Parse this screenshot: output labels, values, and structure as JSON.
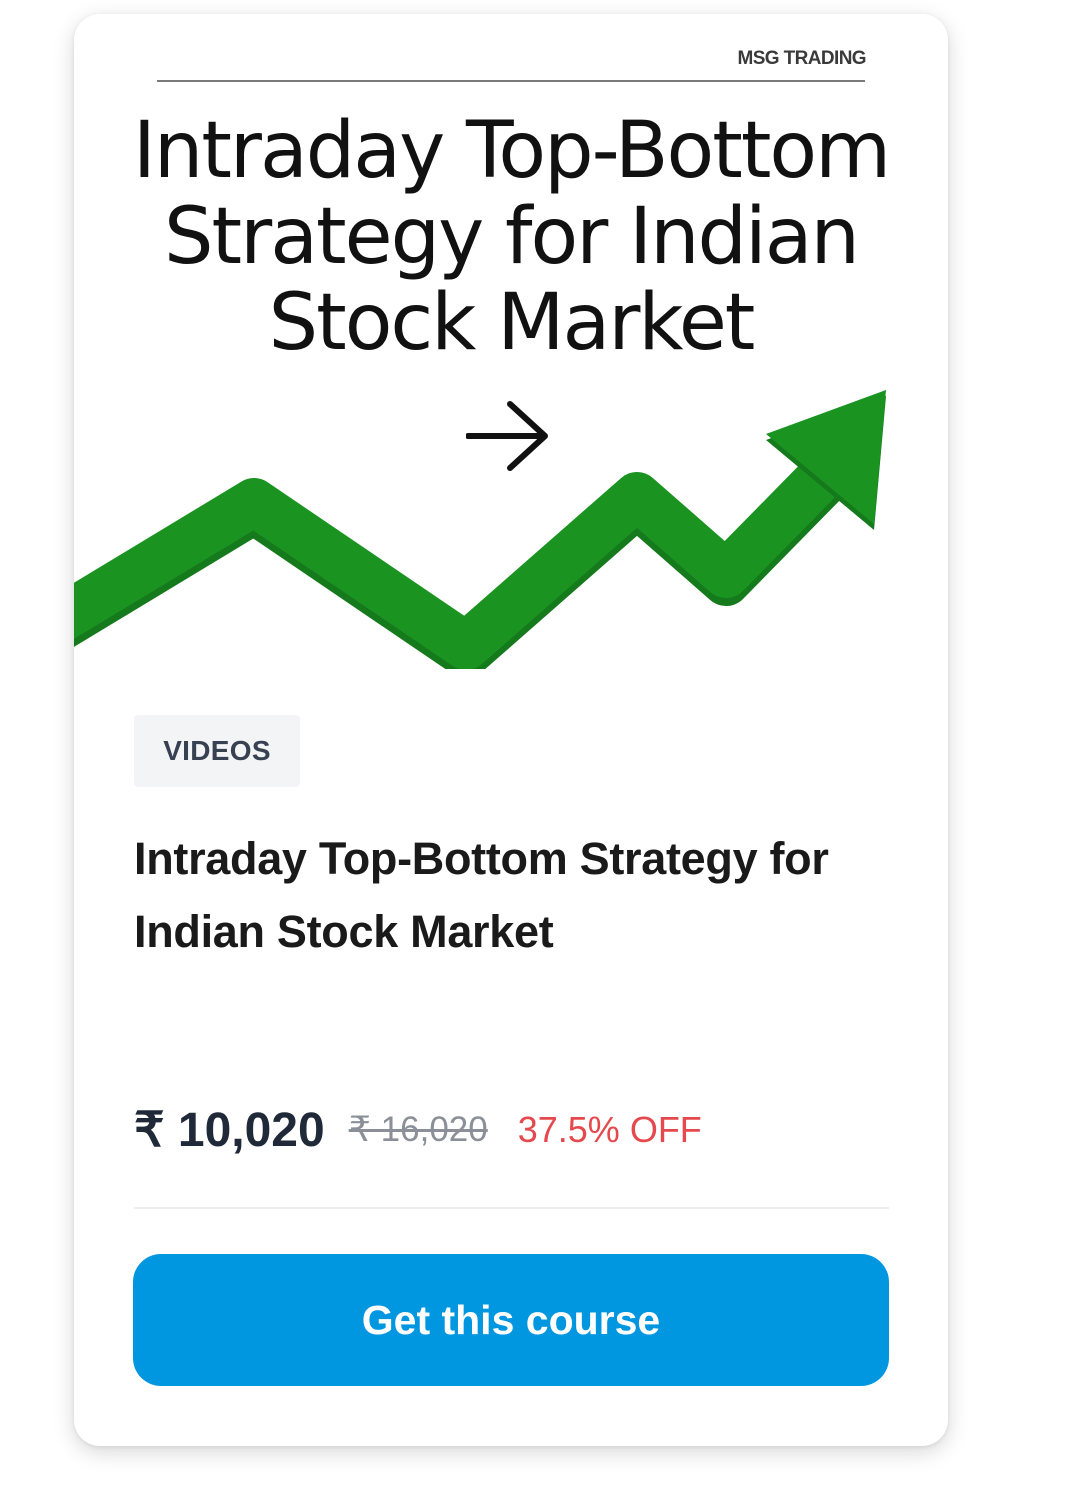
{
  "thumbnail": {
    "brand": "MSG TRADING",
    "title_lines": [
      "Intraday Top-Bottom",
      "Strategy for Indian",
      "Stock Market"
    ],
    "arrow_icon": "arrow-right-icon",
    "chart_icon": "trending-up-arrow-icon",
    "chart_color": "#1a9321"
  },
  "badge": {
    "label": "VIDEOS"
  },
  "course": {
    "title": "Intraday Top-Bottom Strategy for Indian Stock Market"
  },
  "pricing": {
    "price": "₹ 10,020",
    "original_price": "₹ 16,020",
    "discount": "37.5% OFF",
    "discount_color": "#e5484d"
  },
  "cta": {
    "label": "Get this course",
    "color": "#0096e0"
  }
}
